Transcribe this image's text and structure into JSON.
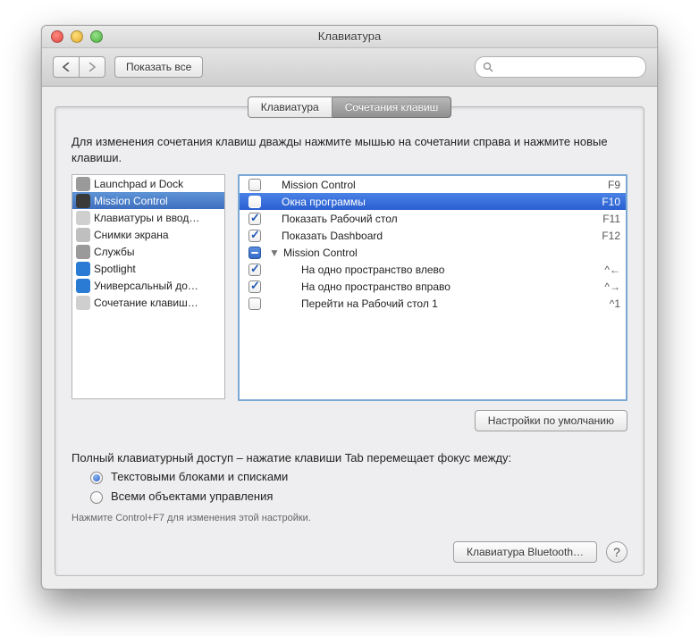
{
  "window": {
    "title": "Клавиатура"
  },
  "toolbar": {
    "show_all": "Показать все",
    "search_placeholder": ""
  },
  "tabs": [
    {
      "label": "Клавиатура",
      "active": false
    },
    {
      "label": "Сочетания клавиш",
      "active": true
    }
  ],
  "instructions": "Для изменения сочетания клавиш дважды нажмите мышью на сочетании справа и нажмите новые клавиши.",
  "categories": [
    {
      "label": "Launchpad и Dock",
      "icon": "launchpad",
      "selected": false
    },
    {
      "label": "Mission Control",
      "icon": "mission",
      "selected": true
    },
    {
      "label": "Клавиатуры и ввод…",
      "icon": "keyboard",
      "selected": false
    },
    {
      "label": "Снимки экрана",
      "icon": "screenshot",
      "selected": false
    },
    {
      "label": "Службы",
      "icon": "services",
      "selected": false
    },
    {
      "label": "Spotlight",
      "icon": "spotlight",
      "selected": false
    },
    {
      "label": "Универсальный до…",
      "icon": "accessibility",
      "selected": false
    },
    {
      "label": "Сочетание клавиш…",
      "icon": "app",
      "selected": false
    }
  ],
  "shortcuts": [
    {
      "checked": false,
      "label": "Mission Control",
      "key": "F9",
      "indent": 0,
      "selected": false
    },
    {
      "checked": false,
      "label": "Окна программы",
      "key": "F10",
      "indent": 0,
      "selected": true
    },
    {
      "checked": true,
      "label": "Показать Рабочий стол",
      "key": "F11",
      "indent": 0,
      "selected": false
    },
    {
      "checked": true,
      "label": "Показать Dashboard",
      "key": "F12",
      "indent": 0,
      "selected": false
    },
    {
      "mixed": true,
      "label": "Mission Control",
      "key": "",
      "indent": 0,
      "header": true,
      "selected": false
    },
    {
      "checked": true,
      "label": "На одно пространство влево",
      "key": "^←",
      "indent": 2,
      "selected": false
    },
    {
      "checked": true,
      "label": "На одно пространство вправо",
      "key": "^→",
      "indent": 2,
      "selected": false
    },
    {
      "checked": false,
      "label": "Перейти на Рабочий стол 1",
      "key": "^1",
      "indent": 2,
      "selected": false
    }
  ],
  "defaults_button": "Настройки по умолчанию",
  "full_access": {
    "heading": "Полный клавиатурный доступ – нажатие клавиши Tab перемещает фокус между:",
    "option_text": "Текстовыми блоками и списками",
    "option_all": "Всеми объектами управления",
    "selected": "text",
    "hint": "Нажмите Control+F7 для изменения этой настройки."
  },
  "footer": {
    "bluetooth": "Клавиатура Bluetooth…"
  },
  "icon_colors": {
    "launchpad": "#9a9a9a",
    "mission": "#3a3a3a",
    "keyboard": "#cfcfcf",
    "screenshot": "#bfbfbf",
    "services": "#9a9a9a",
    "spotlight": "#2a7bd4",
    "accessibility": "#2a7bd4",
    "app": "#cfcfcf"
  }
}
